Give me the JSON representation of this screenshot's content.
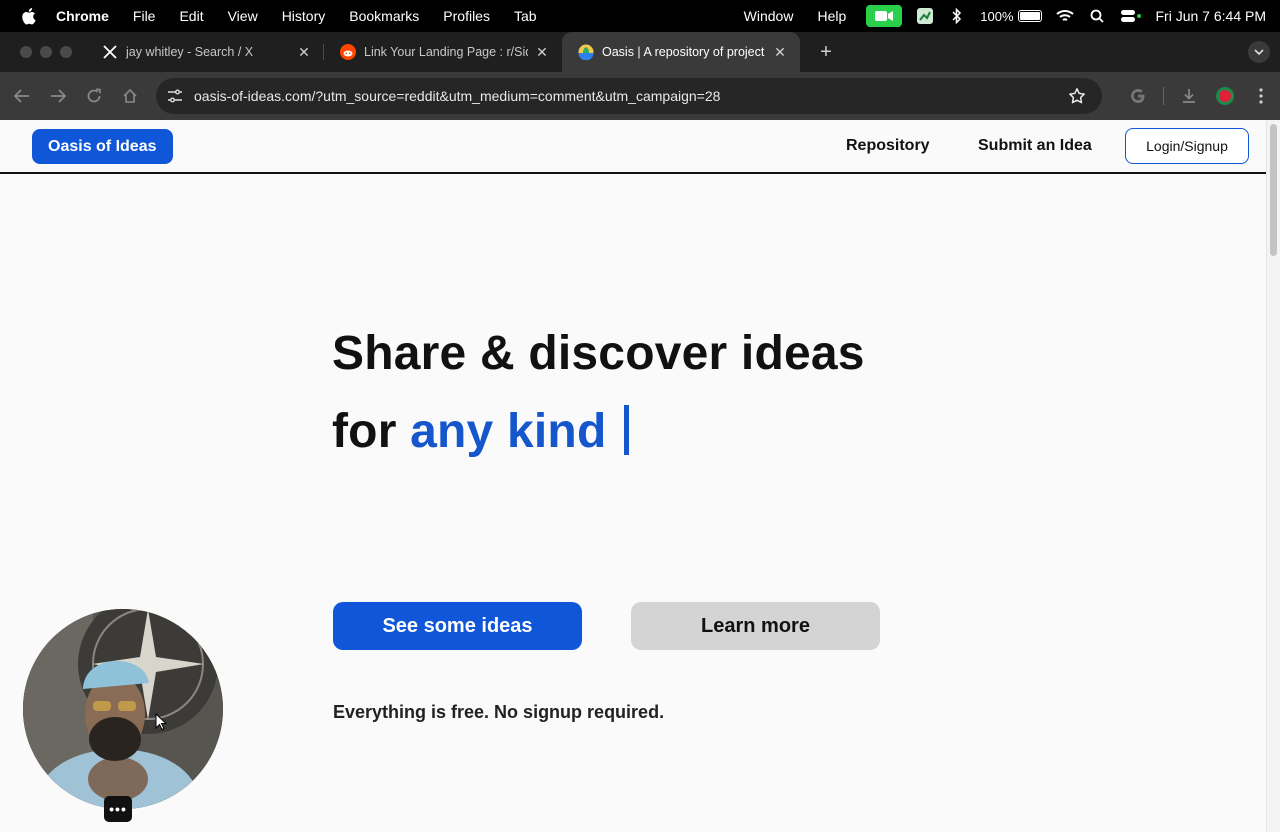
{
  "menubar": {
    "app": "Chrome",
    "items": [
      "File",
      "Edit",
      "View",
      "History",
      "Bookmarks",
      "Profiles",
      "Tab"
    ],
    "right_items": [
      "Window",
      "Help"
    ],
    "battery": "100%",
    "datetime": "Fri Jun 7  6:44 PM"
  },
  "tabs": [
    {
      "title": "jay whitley - Search / X",
      "icon": "x-logo-icon"
    },
    {
      "title": "Link Your Landing Page : r/Sid",
      "icon": "reddit-icon"
    },
    {
      "title": "Oasis | A repository of project",
      "icon": "oasis-favicon-icon",
      "active": true
    }
  ],
  "toolbar": {
    "url": "oasis-of-ideas.com/?utm_source=reddit&utm_medium=comment&utm_campaign=28"
  },
  "site": {
    "brand": "Oasis of Ideas",
    "nav": {
      "repository": "Repository",
      "submit": "Submit an Idea",
      "login": "Login/Signup"
    },
    "hero": {
      "line1": "Share & discover ideas",
      "line2_prefix": "for",
      "line2_accent": "any kind"
    },
    "cta_primary": "See some ideas",
    "cta_secondary": "Learn more",
    "note": "Everything is free. No signup required."
  },
  "colors": {
    "accent": "#0f56d9",
    "accent_text": "#1556cc",
    "secondary_button": "#d4d4d4"
  },
  "webcam": {
    "more_label": "•••"
  }
}
